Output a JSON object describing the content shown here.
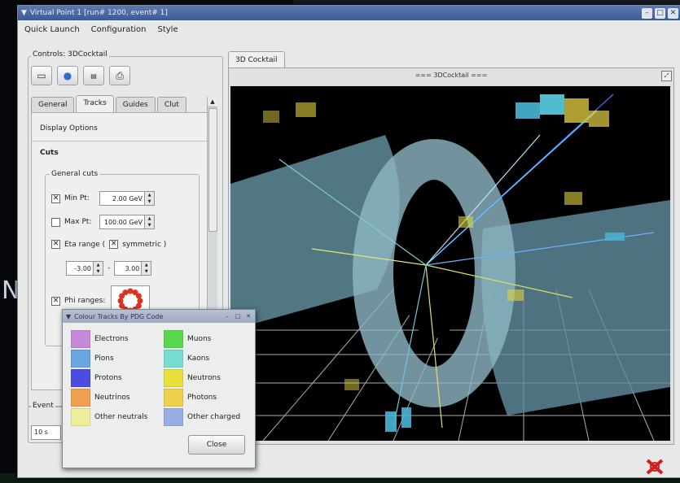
{
  "window": {
    "title": "Virtual Point 1 [run# 1200, event# 1]"
  },
  "menu": [
    "Quick Launch",
    "Configuration",
    "Style"
  ],
  "controls": {
    "title": "Controls: 3DCocktail",
    "tabs": [
      "General",
      "Tracks",
      "Guides",
      "Clut"
    ],
    "display_options": "Display Options",
    "cuts": "Cuts",
    "general_cuts": "General cuts",
    "min_pt": {
      "label": "Min Pt:",
      "value": "2.00 GeV",
      "checked": true
    },
    "max_pt": {
      "label": "Max Pt:",
      "value": "100.00 GeV",
      "checked": false
    },
    "eta_range": {
      "label": "Eta range (",
      "symmetric": "symmetric )",
      "min": "-3.00",
      "max": "3.00",
      "dash": "-"
    },
    "phi_ranges": {
      "label": "Phi ranges:"
    }
  },
  "event": {
    "title": "Event",
    "value": "10 s"
  },
  "viewer": {
    "tab": "3D Cocktail",
    "header": "=== 3DCocktail ==="
  },
  "dialog": {
    "title": "Colour Tracks By PDG Code",
    "items": [
      {
        "label": "Electrons",
        "color": "#c78ad8"
      },
      {
        "label": "Muons",
        "color": "#57d84f"
      },
      {
        "label": "Pions",
        "color": "#6aa5e4"
      },
      {
        "label": "Kaons",
        "color": "#78dcd0"
      },
      {
        "label": "Protons",
        "color": "#4c4de0"
      },
      {
        "label": "Neutrons",
        "color": "#e6df3c"
      },
      {
        "label": "Neutrinos",
        "color": "#efa050"
      },
      {
        "label": "Photons",
        "color": "#eed04c"
      },
      {
        "label": "Other neutrals",
        "color": "#eeed9a"
      },
      {
        "label": "Other charged",
        "color": "#9aaee4"
      }
    ],
    "close": "Close"
  }
}
